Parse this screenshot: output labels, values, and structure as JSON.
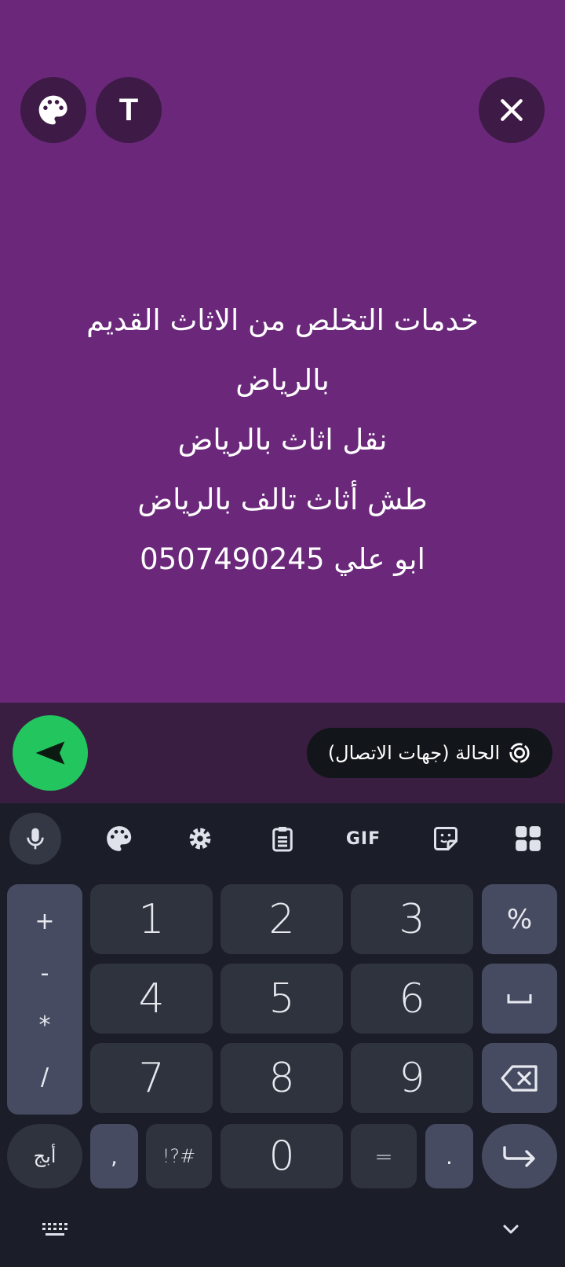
{
  "composer": {
    "background": "#6b287b",
    "text_style_label": "T",
    "status_text": "خدمات التخلص من الاثاث القديم\nبالرياض\nنقل اثاث بالرياض\nطش أثاث تالف بالرياض\nابو علي 0507490245",
    "icons": {
      "palette": "palette-icon",
      "close": "close-icon"
    }
  },
  "send_bar": {
    "audience_label": "الحالة (جهات الاتصال)",
    "send_color": "#22c55e",
    "icons": {
      "send": "send-icon",
      "audience": "status-ring-icon"
    }
  },
  "keyboard": {
    "toolbar": {
      "gif_label": "GIF",
      "icons": [
        "mic-icon",
        "palette-icon",
        "settings-gear-icon",
        "clipboard-icon",
        "gif-icon",
        "sticker-icon",
        "apps-grid-icon"
      ]
    },
    "ops": [
      "+",
      "-",
      "*",
      "/"
    ],
    "digits": [
      "1",
      "2",
      "3",
      "4",
      "5",
      "6",
      "7",
      "8",
      "9",
      "0"
    ],
    "right_keys": {
      "percent": "%",
      "space_icon": "space-icon",
      "backspace_icon": "backspace-icon",
      "enter_icon": "enter-icon"
    },
    "bottom": {
      "alpha": "أبج",
      "comma": ",",
      "symbols": "!?#",
      "equals": "=",
      "period": "."
    },
    "nav_icons": [
      "keyboard-switch-icon",
      "chevron-down-icon"
    ]
  }
}
